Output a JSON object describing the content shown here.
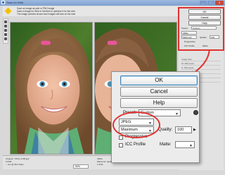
{
  "window": {
    "title": "Save for Web",
    "controls": {
      "min": "_",
      "max": "□",
      "close": "X"
    }
  },
  "infobar": {
    "lines": [
      "Save an image as web or PNG image",
      "Save a image for Web or Devices to optimize it for the web",
      "The image preview shows how images will look on the web"
    ]
  },
  "statusbar": {
    "left": [
      "Original: \"0704_2728.jpg\"",
      "6.04M",
      "-- sec @ 56.6 Kbps"
    ],
    "right": [
      "JPEG",
      "Maximum quality",
      "1.21M"
    ],
    "zoom": "50%"
  },
  "mini_panel": {
    "ok": "OK",
    "cancel": "Cancel",
    "help": "Help",
    "preset_label": "Preset:",
    "preset_value": "Custom",
    "format": "JPEG",
    "quality_level": "Maximum",
    "quality_label": "Quality:",
    "quality_value": "100",
    "progressive": "Progressive",
    "icc": "ICC Profile",
    "matte": "Matte:"
  },
  "right_panel": {
    "rows": [
      "Image Size",
      "W: 480 pixels",
      "H: 640 pixels",
      "Percent: 100",
      "Quality: Bicubic",
      "Animation"
    ]
  },
  "callout": {
    "ok": "OK",
    "cancel": "Cancel",
    "help": "Help",
    "preset_label": "Preset:",
    "preset_value": "Custom",
    "format": "JPEG",
    "quality_level": "Maximum",
    "quality_label": "Quality:",
    "quality_value": "100",
    "progressive": "Progressive",
    "icc": "ICC Profile",
    "matte": "Matte:"
  },
  "icons": {
    "warning": "warning-icon",
    "menu": "menu-circle-icon"
  },
  "colors": {
    "annotation": "#e23030",
    "ok_border": "#3c7fb1"
  }
}
